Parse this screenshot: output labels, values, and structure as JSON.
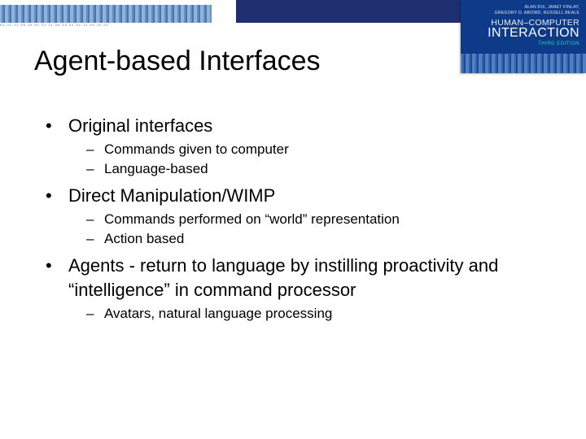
{
  "book": {
    "authors_line1": "ALAN DIX, JANET FINLAY,",
    "authors_line2": "GREGORY D. ABOWD, RUSSELL BEALE",
    "title_line1": "HUMAN–COMPUTER",
    "title_line2": "INTERACTION",
    "edition": "THIRD EDITION"
  },
  "title": "Agent-based Interfaces",
  "bullets": [
    {
      "text": "Original interfaces",
      "sub": [
        "Commands given to computer",
        "Language-based"
      ]
    },
    {
      "text": "Direct Manipulation/WIMP",
      "sub": [
        "Commands performed on “world” representation",
        "Action based"
      ]
    },
    {
      "text": "Agents - return to language by instilling proactivity and “intelligence” in command processor",
      "sub": [
        "Avatars, natural language processing"
      ]
    }
  ]
}
